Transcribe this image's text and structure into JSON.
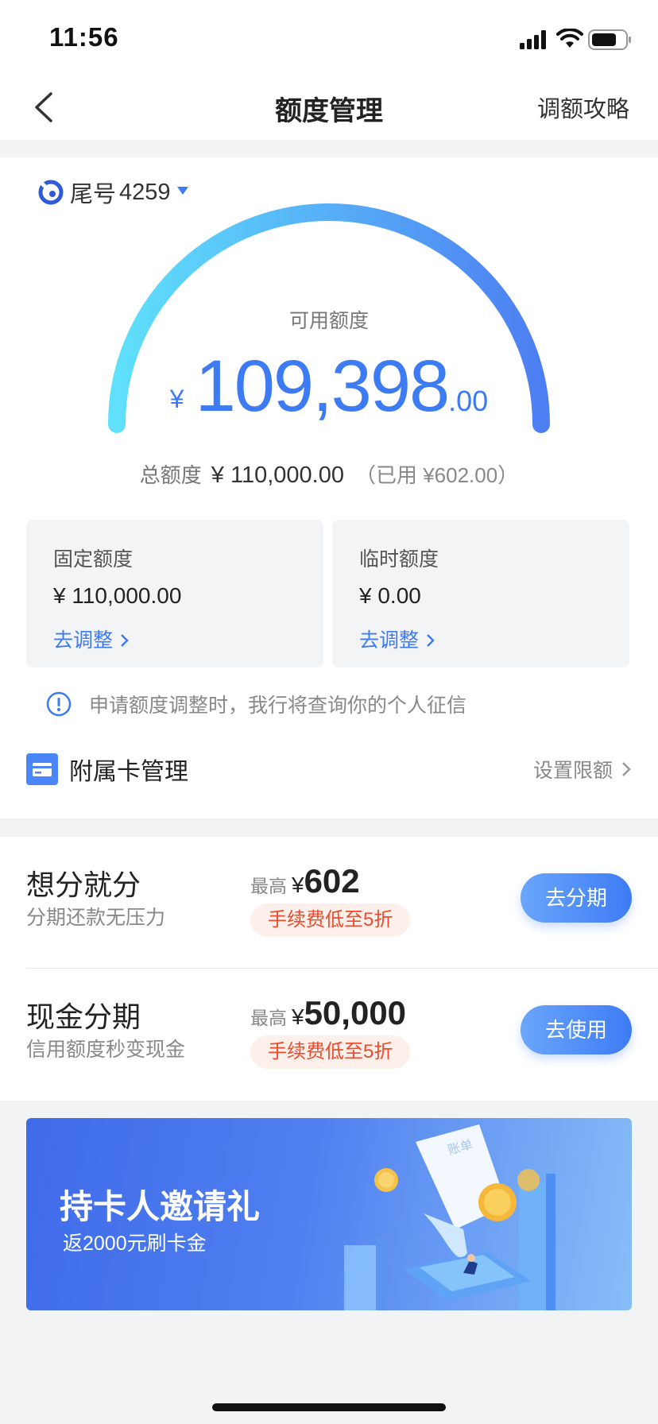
{
  "status_bar": {
    "time": "11:56"
  },
  "nav": {
    "title": "额度管理",
    "guide_label": "调额攻略"
  },
  "account": {
    "tail_label": "尾号",
    "tail_number": "4259"
  },
  "credit": {
    "available_label": "可用额度",
    "currency": "¥",
    "available_integer": "109,398",
    "available_decimal": ".00",
    "available_fraction_of_total": 0.9945,
    "total_label": "总额度",
    "total_value": "¥ 110,000.00",
    "used_text": "（已用 ¥602.00）"
  },
  "boxes": [
    {
      "label": "固定额度",
      "value": "¥ 110,000.00",
      "action": "去调整"
    },
    {
      "label": "临时额度",
      "value": "¥ 0.00",
      "action": "去调整"
    }
  ],
  "notice": "申请额度调整时，我行将查询你的个人征信",
  "sub_card": {
    "label": "附属卡管理",
    "action": "设置限额"
  },
  "installments": [
    {
      "title": "想分就分",
      "subtitle": "分期还款无压力",
      "max_label": "最高",
      "currency": "¥",
      "max_value": "602",
      "fee": "手续费低至5折",
      "button": "去分期"
    },
    {
      "title": "现金分期",
      "subtitle": "信用额度秒变现金",
      "max_label": "最高",
      "currency": "¥",
      "max_value": "50,000",
      "fee": "手续费低至5折",
      "button": "去使用"
    }
  ],
  "banner": {
    "title": "持卡人邀请礼",
    "subtitle": "返2000元刷卡金",
    "illustration_text": "账单"
  },
  "colors": {
    "accent": "#3d7bf5",
    "fee_text": "#ef4a2c",
    "gauge_start": "#5fe0fb",
    "gauge_end": "#4d7ef2"
  }
}
